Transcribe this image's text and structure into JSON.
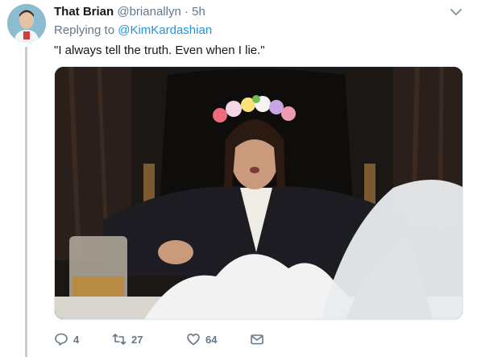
{
  "tweet": {
    "display_name": "That Brian",
    "handle": "@brianallyn",
    "separator": "·",
    "time": "5h",
    "replying_prefix": "Replying to",
    "replying_to": "@KimKardashian",
    "text": "\"I always tell the truth. Even when I lie.\""
  },
  "media": {
    "icon": "image",
    "description_colors": {
      "background": "#1a1512",
      "powder": "#f2f2f2"
    }
  },
  "actions": {
    "reply_count": "4",
    "retweet_count": "27",
    "like_count": "64",
    "icons": [
      "reply-icon",
      "retweet-icon",
      "like-icon",
      "message-icon"
    ]
  },
  "colors": {
    "name": "#14171a",
    "secondary": "#657786",
    "link": "#1b95e0",
    "thread_line": "#c4cdd4"
  }
}
